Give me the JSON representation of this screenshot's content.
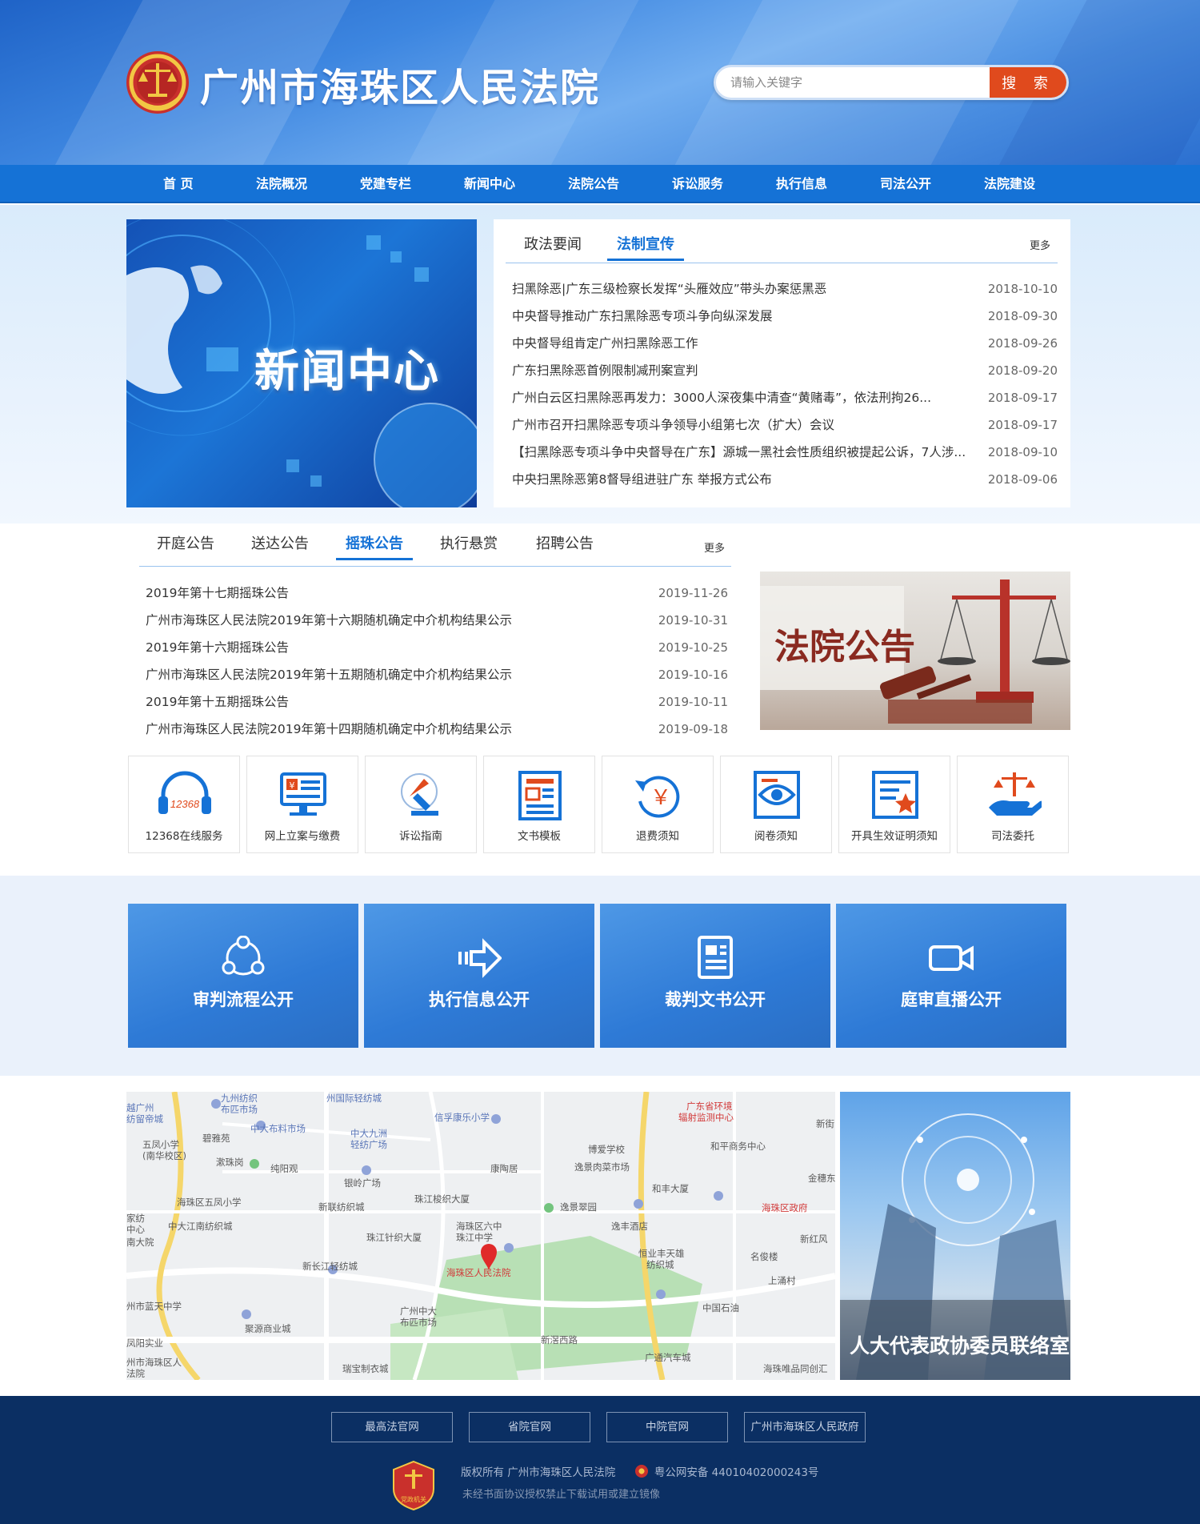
{
  "header": {
    "site_title": "广州市海珠区人民法院",
    "search_placeholder": "请输入关键字",
    "search_button": "搜 索"
  },
  "nav": [
    "首 页",
    "法院概况",
    "党建专栏",
    "新闻中心",
    "法院公告",
    "诉讼服务",
    "执行信息",
    "司法公开",
    "法院建设"
  ],
  "news": {
    "banner_title": "新闻中心",
    "tabs": [
      "政法要闻",
      "法制宣传"
    ],
    "active_tab": "法制宣传",
    "more": "更多",
    "items": [
      {
        "title": "扫黑除恶|广东三级检察长发挥“头雁效应”带头办案惩黑恶",
        "date": "2018-10-10"
      },
      {
        "title": "中央督导推动广东扫黑除恶专项斗争向纵深发展",
        "date": "2018-09-30"
      },
      {
        "title": "中央督导组肯定广州扫黑除恶工作",
        "date": "2018-09-26"
      },
      {
        "title": "广东扫黑除恶首例限制减刑案宣判",
        "date": "2018-09-20"
      },
      {
        "title": "广州白云区扫黑除恶再发力：3000人深夜集中清查“黄赌毒”，依法刑拘26...",
        "date": "2018-09-17"
      },
      {
        "title": "广州市召开扫黑除恶专项斗争领导小组第七次（扩大）会议",
        "date": "2018-09-17"
      },
      {
        "title": "【扫黑除恶专项斗争中央督导在广东】源城一黑社会性质组织被提起公诉，7人涉...",
        "date": "2018-09-10"
      },
      {
        "title": "中央扫黑除恶第8督导组进驻广东 举报方式公布",
        "date": "2018-09-06"
      }
    ]
  },
  "notices": {
    "tabs": [
      "开庭公告",
      "送达公告",
      "摇珠公告",
      "执行悬赏",
      "招聘公告"
    ],
    "active_tab": "摇珠公告",
    "more": "更多",
    "banner_title": "法院公告",
    "items": [
      {
        "title": "2019年第十七期摇珠公告",
        "date": "2019-11-26"
      },
      {
        "title": "广州市海珠区人民法院2019年第十六期随机确定中介机构结果公示",
        "date": "2019-10-31"
      },
      {
        "title": "2019年第十六期摇珠公告",
        "date": "2019-10-25"
      },
      {
        "title": "广州市海珠区人民法院2019年第十五期随机确定中介机构结果公示",
        "date": "2019-10-16"
      },
      {
        "title": "2019年第十五期摇珠公告",
        "date": "2019-10-11"
      },
      {
        "title": "广州市海珠区人民法院2019年第十四期随机确定中介机构结果公示",
        "date": "2019-09-18"
      }
    ]
  },
  "services": [
    {
      "label": "12368在线服务",
      "icon": "headset-icon"
    },
    {
      "label": "网上立案与缴费",
      "icon": "online-filing-icon"
    },
    {
      "label": "诉讼指南",
      "icon": "guide-icon"
    },
    {
      "label": "文书模板",
      "icon": "document-template-icon"
    },
    {
      "label": "退费须知",
      "icon": "refund-icon"
    },
    {
      "label": "阅卷须知",
      "icon": "file-review-icon"
    },
    {
      "label": "开具生效证明须知",
      "icon": "certificate-icon"
    },
    {
      "label": "司法委托",
      "icon": "judicial-entrust-icon"
    }
  ],
  "service_icon_texts": {
    "hotline": "12368",
    "currency": "¥",
    "refund_currency": "￥"
  },
  "publicity": [
    {
      "label": "审判流程公开",
      "icon": "process-icon"
    },
    {
      "label": "执行信息公开",
      "icon": "arrow-icon"
    },
    {
      "label": "裁判文书公开",
      "icon": "document-icon"
    },
    {
      "label": "庭审直播公开",
      "icon": "video-camera-icon"
    }
  ],
  "map": {
    "court_label": "海珠区人民法院",
    "labels": [
      "九州纺织布匹市场",
      "州国际轻纺城",
      "越广州纺留帝城",
      "中大布料市场",
      "中大九洲轻纺广场",
      "信孚康乐小学",
      "广东省环境辐射监测中心",
      "新街",
      "五凤小学(南华校区)",
      "碧雅苑",
      "漱珠岗",
      "纯阳观",
      "博爱学校",
      "和平商务中心",
      "银岭广场",
      "康陶居",
      "逸景肉菜市场",
      "金穗东",
      "海珠区五凤小学",
      "新联纺织城",
      "珠江梭织大厦",
      "和丰大厦",
      "中大江南纺织城",
      "逸景翠园",
      "海珠区政府",
      "珠江针织大厦",
      "海珠区六中珠江中学",
      "逸丰酒店",
      "新红风",
      "新长江轻纺城",
      "恒业丰天雄纺织城",
      "名俊楼",
      "上涌村",
      "州市蓝天中学",
      "广州中大布匹市场",
      "中国石油",
      "聚源商业城",
      "新滘西路",
      "凤阳实业",
      "州市海珠区人法院",
      "瑞宝制衣城",
      "广通汽车城",
      "海珠唯品同创汇",
      "中大江南",
      "南大院"
    ]
  },
  "contact_label": "人大代表政协委员联络室",
  "footer": {
    "links": [
      "最高法官网",
      "省院官网",
      "中院官网",
      "广州市海珠区人民政府"
    ],
    "copyright": "版权所有 广州市海珠区人民法院",
    "police": "粤公网安备 44010402000243号",
    "disclaimer": "未经书面协议授权禁止下载试用或建立镜像",
    "badge_text": "党政机关"
  },
  "colors": {
    "nav": "#1572d6",
    "search_button": "#e04a1d",
    "footer": "#0b2f63",
    "accent": "#1572d6"
  }
}
